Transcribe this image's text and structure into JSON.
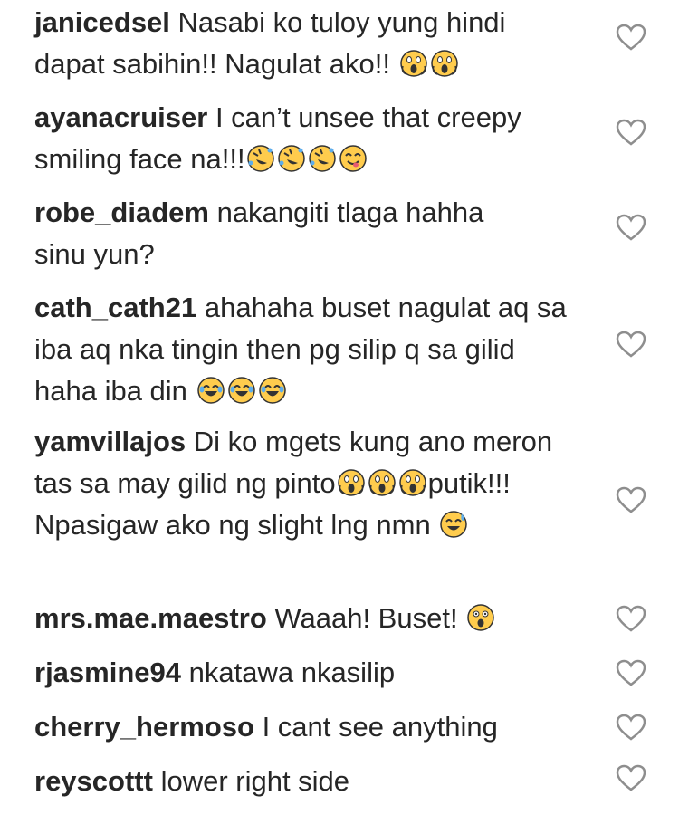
{
  "comments": [
    {
      "username": "janicedsel",
      "text": "Nasabi ko tuloy yung hindi dapat sabihin!! Nagulat ako!!",
      "emojis": [
        "scream-emoji",
        "scream-emoji"
      ]
    },
    {
      "username": "ayanacruiser",
      "text": "I can’t unsee that creepy smiling face na!!!",
      "emojis": [
        "rofl-emoji",
        "rofl-emoji",
        "rofl-emoji",
        "yum-emoji"
      ]
    },
    {
      "username": "robe_diadem",
      "text": "nakangiti tlaga hahha sinu yun?",
      "emojis": []
    },
    {
      "username": "cath_cath21",
      "text": "ahahaha buset nagulat aq sa iba aq nka tingin then pg silip q sa gilid haha iba din",
      "emojis": [
        "joy-emoji",
        "joy-emoji",
        "joy-emoji"
      ]
    },
    {
      "username": "yamvillajos",
      "text": "Di ko mgets kung ano meron tas sa may gilid ng pinto",
      "text2": "putik!!! Npasigaw ako ng slight lng nmn",
      "emojis": [
        "scream-emoji",
        "scream-emoji"
      ],
      "emojis2": [
        "scream-emoji"
      ],
      "emojis3": [
        "sweat-smile-emoji"
      ]
    },
    {
      "username": "mrs.mae.maestro",
      "text": "Waaah! Buset!",
      "emojis": [
        "astonished-emoji"
      ]
    },
    {
      "username": "rjasmine94",
      "text": "nkatawa nkasilip",
      "emojis": []
    },
    {
      "username": "cherry_hermoso",
      "text": "I cant see anything",
      "emojis": []
    },
    {
      "username": "reyscottt",
      "text": "lower right side",
      "emojis": []
    }
  ],
  "icons": {
    "like": "heart-outline-icon"
  },
  "colors": {
    "text": "#262626",
    "icon": "#8e8e8e",
    "emoji_face": "#ffcc4d"
  }
}
